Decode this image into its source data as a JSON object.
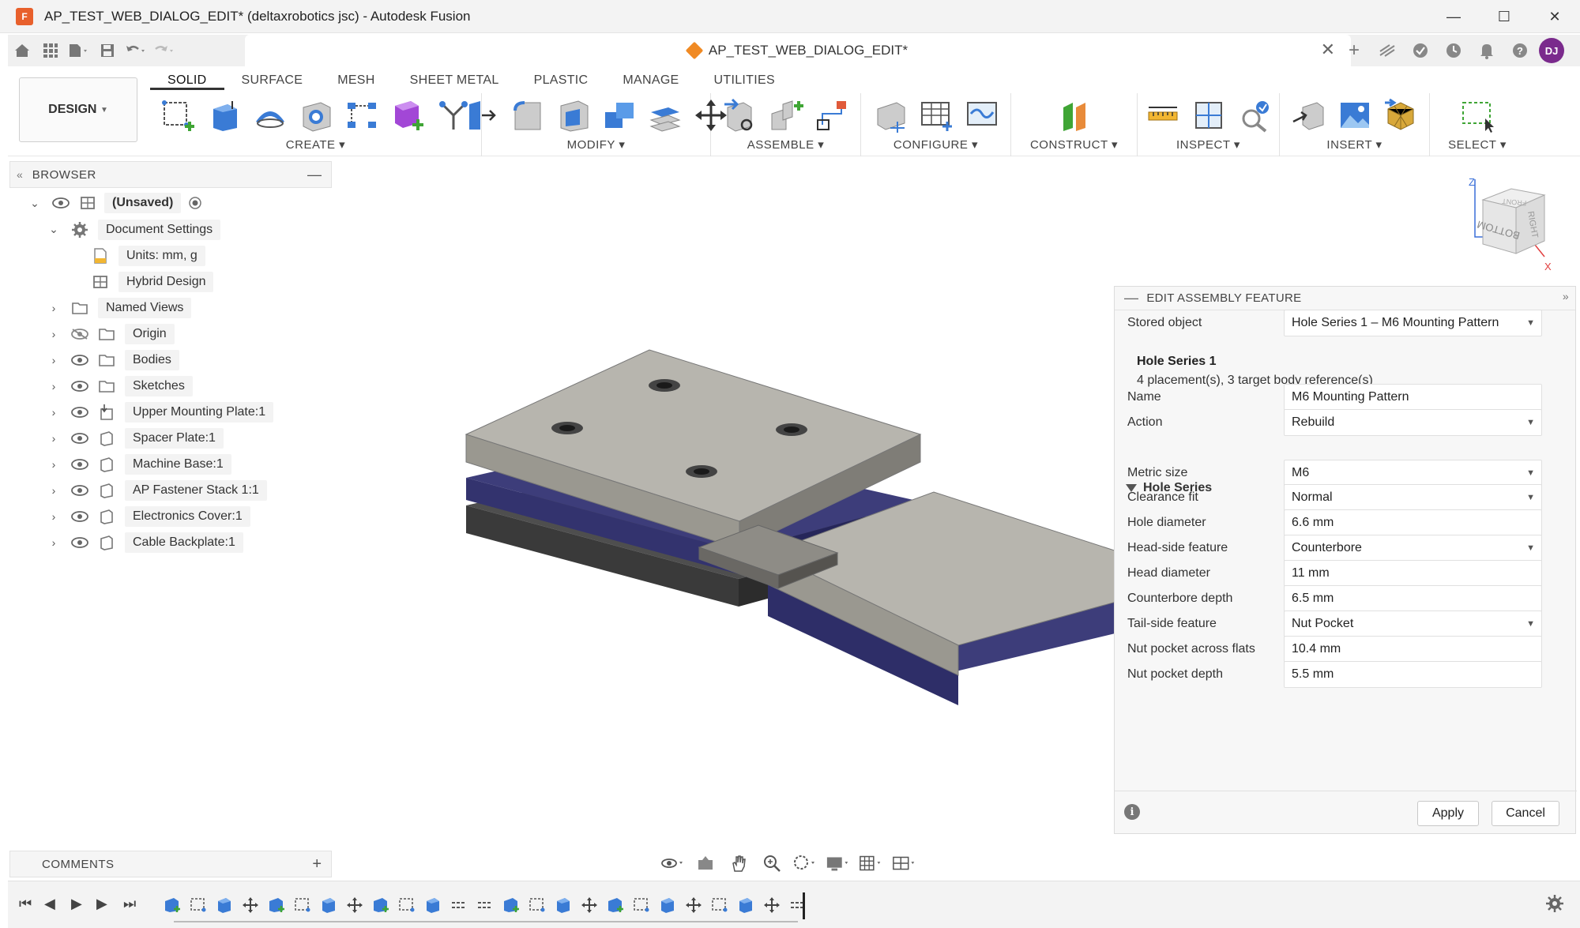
{
  "window": {
    "title": "AP_TEST_WEB_DIALOG_EDIT* (deltaxrobotics jsc) - Autodesk Fusion",
    "app_logo": "F"
  },
  "doc_tab": {
    "title": "AP_TEST_WEB_DIALOG_EDIT*"
  },
  "user": {
    "initials": "DJ",
    "avatar_color": "#7a2a8c"
  },
  "ribbon": {
    "workspace": "DESIGN",
    "tabs": [
      "SOLID",
      "SURFACE",
      "MESH",
      "SHEET METAL",
      "PLASTIC",
      "MANAGE",
      "UTILITIES"
    ],
    "active_tab": "SOLID",
    "groups": [
      "CREATE",
      "MODIFY",
      "ASSEMBLE",
      "CONFIGURE",
      "CONSTRUCT",
      "INSPECT",
      "INSERT",
      "SELECT"
    ]
  },
  "browser": {
    "title": "BROWSER",
    "root": "(Unsaved)",
    "items": [
      {
        "label": "Document Settings"
      },
      {
        "label": "Units: mm, g"
      },
      {
        "label": "Hybrid Design"
      },
      {
        "label": "Named Views"
      },
      {
        "label": "Origin"
      },
      {
        "label": "Bodies"
      },
      {
        "label": "Sketches"
      },
      {
        "label": "Upper Mounting Plate:1"
      },
      {
        "label": "Spacer Plate:1"
      },
      {
        "label": "Machine Base:1"
      },
      {
        "label": "AP Fastener Stack 1:1"
      },
      {
        "label": "Electronics Cover:1"
      },
      {
        "label": "Cable Backplate:1"
      }
    ]
  },
  "viewcube": {
    "face_front": "BOTTOM",
    "face_right": "RIGHT",
    "face_top": "FRONT",
    "axis_z": "Z",
    "axis_x": "X"
  },
  "panel": {
    "title": "EDIT ASSEMBLY FEATURE",
    "stored_object_label": "Stored object",
    "stored_object_value": "Hole Series 1 – M6 Mounting Pattern",
    "info_title": "Hole Series 1",
    "info_sub": "4 placement(s), 3 target body reference(s)",
    "name_label": "Name",
    "name_value": "M6 Mounting Pattern",
    "action_label": "Action",
    "action_value": "Rebuild",
    "section_title": "Hole Series",
    "metric_size_label": "Metric size",
    "metric_size_value": "M6",
    "clearance_label": "Clearance fit",
    "clearance_value": "Normal",
    "hole_diameter_label": "Hole diameter",
    "hole_diameter_value": "6.6 mm",
    "head_feature_label": "Head-side feature",
    "head_feature_value": "Counterbore",
    "head_diameter_label": "Head diameter",
    "head_diameter_value": "11 mm",
    "cb_depth_label": "Counterbore depth",
    "cb_depth_value": "6.5 mm",
    "tail_feature_label": "Tail-side feature",
    "tail_feature_value": "Nut Pocket",
    "nut_flats_label": "Nut pocket across flats",
    "nut_flats_value": "10.4 mm",
    "nut_depth_label": "Nut pocket depth",
    "nut_depth_value": "5.5 mm",
    "apply_label": "Apply",
    "cancel_label": "Cancel"
  },
  "comments": {
    "title": "COMMENTS"
  }
}
